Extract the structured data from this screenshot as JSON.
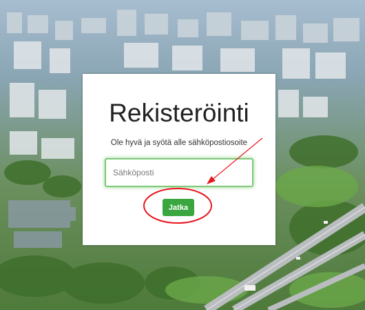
{
  "form": {
    "title": "Rekisteröinti",
    "instruction": "Ole hyvä ja syötä alle sähköpostiosoite",
    "email_placeholder": "Sähköposti",
    "email_value": "",
    "submit_label": "Jatka"
  },
  "colors": {
    "card_background": "#ffffff",
    "button_green": "#3aa640",
    "input_focus_green": "#7ec878",
    "annotation_red": "#e8141c"
  },
  "background": {
    "description": "aerial-city-photo"
  }
}
